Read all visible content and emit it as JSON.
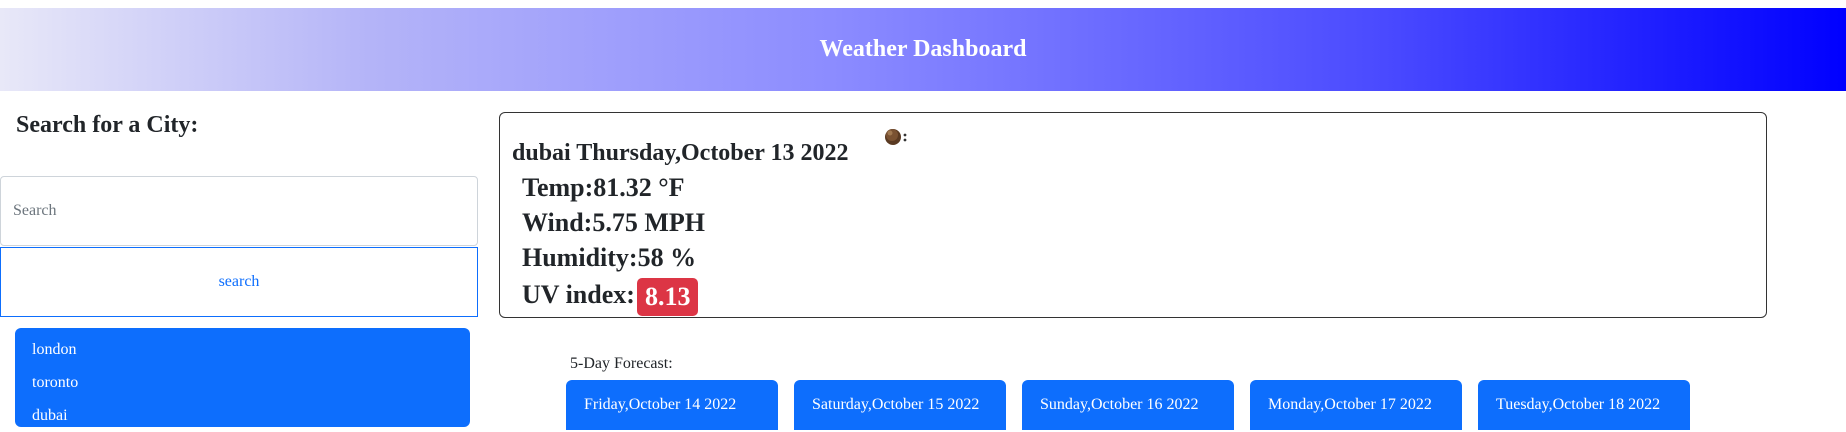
{
  "header": {
    "title": "Weather Dashboard",
    "gradient_start": "#e8e8f8",
    "gradient_end": "#0000ff"
  },
  "sidebar": {
    "heading": "Search for a City:",
    "search_placeholder": "Search",
    "search_value": "",
    "search_button_label": "search",
    "history": [
      "london",
      "toronto",
      "dubai"
    ]
  },
  "current": {
    "city_date": "dubai Thursday,October 13 2022",
    "icon": "cloud-icon",
    "temp": "Temp:81.32 °F",
    "wind": "Wind:5.75 MPH",
    "humidity": "Humidity:58 %",
    "uv_label": "UV index:",
    "uv_value": "8.13",
    "uv_color": "#dc3545"
  },
  "forecast": {
    "title": "5-Day Forecast:",
    "days": [
      "Friday,October 14 2022",
      "Saturday,October 15 2022",
      "Sunday,October 16 2022",
      "Monday,October 17 2022",
      "Tuesday,October 18 2022"
    ]
  },
  "colors": {
    "accent": "#0d6efd",
    "uv_badge": "#dc3545"
  }
}
